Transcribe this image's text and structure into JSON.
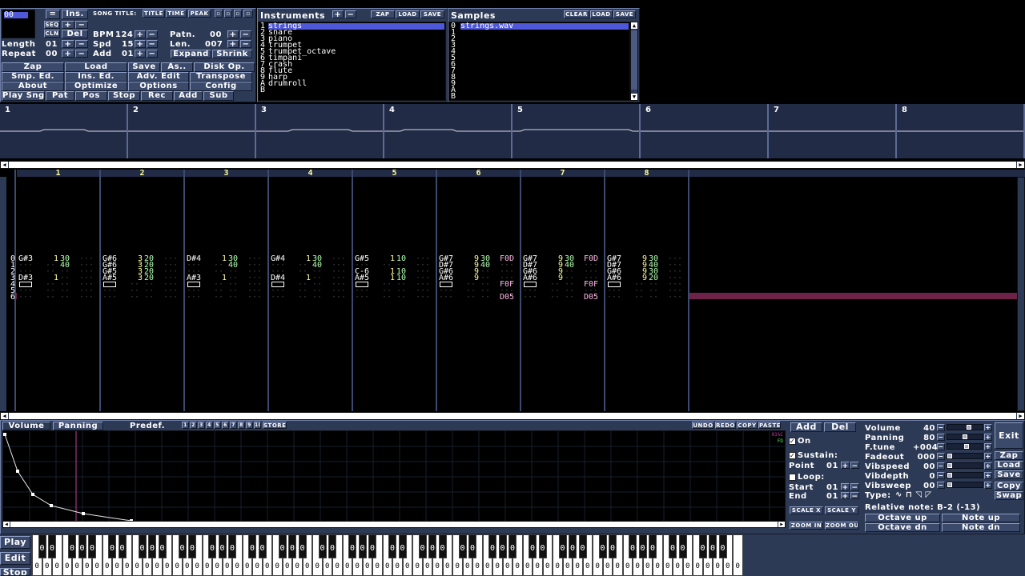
{
  "song": {
    "length_label": "Length",
    "length": "01",
    "repeat_label": "Repeat",
    "repeat": "00",
    "title_label": "SONG TITLE:",
    "title_tab": "TITLE",
    "time_tab": "TIME",
    "peak_tab": "PEAK",
    "bpm_label": "BPM",
    "bpm": "124",
    "spd_label": "Spd",
    "spd": "15",
    "add_label": "Add",
    "add": "01",
    "patn_label": "Patn.",
    "patn": "00",
    "len_label": "Len.",
    "len": "007",
    "expand": "Expand",
    "shrink": "Shrink",
    "pos_display": "00",
    "ins_btn": "Ins.",
    "del_btn": "Del",
    "seq_btn": "SEQ",
    "cln_btn": "CLN",
    "plus": "+",
    "minus": "−"
  },
  "main_buttons": [
    [
      "Zap",
      "Load",
      "Save",
      "As..",
      "Disk Op."
    ],
    [
      "Smp. Ed.",
      "Ins. Ed.",
      "Adv. Edit",
      "Transpose"
    ],
    [
      "About",
      "Optimize",
      "Options",
      "Config"
    ],
    [
      "Play Sng",
      "Pat",
      "Pos",
      "Stop",
      "Rec",
      "Add",
      "Sub"
    ]
  ],
  "instruments": {
    "title": "Instruments",
    "zap": "ZAP",
    "load": "LOAD",
    "save": "SAVE",
    "numbers": [
      "1",
      "2",
      "3",
      "4",
      "5",
      "6",
      "7",
      "8",
      "9",
      "A",
      "B"
    ],
    "items": [
      "strings",
      "snare",
      "piano",
      "trumpet",
      "trumpet_octave",
      "timpani",
      "crash",
      "flute",
      "harp",
      "drumroll",
      ""
    ]
  },
  "samples": {
    "title": "Samples",
    "clear": "CLEAR",
    "load": "LOAD",
    "save": "SAVE",
    "numbers": [
      "0",
      "1",
      "2",
      "3",
      "4",
      "5",
      "6",
      "7",
      "8",
      "9",
      "A",
      "B"
    ],
    "items": [
      "strings.wav",
      "",
      "",
      "",
      "",
      "",
      "",
      "",
      "",
      "",
      "",
      ""
    ]
  },
  "scopes": [
    "1",
    "2",
    "3",
    "4",
    "5",
    "6",
    "7",
    "8"
  ],
  "pattern": {
    "tracks": [
      "1",
      "2",
      "3",
      "4",
      "5",
      "6",
      "7",
      "8"
    ],
    "rows": [
      "0",
      "1",
      "2",
      "3",
      "4",
      "5",
      "6"
    ],
    "cells": [
      [
        [
          "G#3",
          "1",
          "30",
          ""
        ],
        [
          "",
          "",
          "40",
          ""
        ],
        [
          "",
          "",
          "",
          ""
        ],
        [
          "D#3",
          "1",
          "",
          ""
        ],
        [
          "===",
          "",
          "",
          ""
        ],
        [
          "",
          "",
          "",
          ""
        ],
        [
          "",
          "",
          "",
          ""
        ]
      ],
      [
        [
          "G#6",
          "3",
          "20",
          ""
        ],
        [
          "G#6",
          "3",
          "20",
          ""
        ],
        [
          "G#5",
          "3",
          "20",
          ""
        ],
        [
          "A#5",
          "3",
          "20",
          ""
        ],
        [
          "===",
          "",
          "",
          ""
        ],
        [
          "",
          "",
          "",
          ""
        ],
        [
          "",
          "",
          "",
          ""
        ]
      ],
      [
        [
          "D#4",
          "1",
          "30",
          ""
        ],
        [
          "",
          "",
          "40",
          ""
        ],
        [
          "",
          "",
          "",
          ""
        ],
        [
          "A#3",
          "1",
          "",
          ""
        ],
        [
          "===",
          "",
          "",
          ""
        ],
        [
          "",
          "",
          "",
          ""
        ],
        [
          "",
          "",
          "",
          ""
        ]
      ],
      [
        [
          "G#4",
          "1",
          "30",
          ""
        ],
        [
          "",
          "",
          "40",
          ""
        ],
        [
          "",
          "",
          "",
          ""
        ],
        [
          "D#4",
          "1",
          "",
          ""
        ],
        [
          "===",
          "",
          "",
          ""
        ],
        [
          "",
          "",
          "",
          ""
        ],
        [
          "",
          "",
          "",
          ""
        ]
      ],
      [
        [
          "G#5",
          "1",
          "10",
          ""
        ],
        [
          "",
          "",
          "",
          ""
        ],
        [
          "C-6",
          "1",
          "10",
          ""
        ],
        [
          "A#5",
          "1",
          "10",
          ""
        ],
        [
          "===",
          "",
          "",
          ""
        ],
        [
          "",
          "",
          "",
          ""
        ],
        [
          "",
          "",
          "",
          ""
        ]
      ],
      [
        [
          "G#7",
          "9",
          "30",
          "F0D"
        ],
        [
          "D#7",
          "9",
          "40",
          ""
        ],
        [
          "G#6",
          "9",
          "",
          ""
        ],
        [
          "A#6",
          "9",
          "",
          ""
        ],
        [
          "===",
          "",
          "",
          "F0F"
        ],
        [
          "",
          "",
          "",
          ""
        ],
        [
          "",
          "",
          "",
          "D05"
        ]
      ],
      [
        [
          "G#7",
          "9",
          "30",
          "F0D"
        ],
        [
          "D#7",
          "9",
          "40",
          ""
        ],
        [
          "G#6",
          "9",
          "",
          ""
        ],
        [
          "A#6",
          "9",
          "",
          ""
        ],
        [
          "===",
          "",
          "",
          "F0F"
        ],
        [
          "",
          "",
          "",
          ""
        ],
        [
          "",
          "",
          "",
          "D05"
        ]
      ],
      [
        [
          "G#7",
          "9",
          "30",
          ""
        ],
        [
          "D#7",
          "9",
          "40",
          ""
        ],
        [
          "G#6",
          "9",
          "30",
          ""
        ],
        [
          "A#6",
          "9",
          "20",
          ""
        ],
        [
          "===",
          "",
          "",
          ""
        ],
        [
          "",
          "",
          "",
          ""
        ],
        [
          "",
          "",
          "",
          ""
        ]
      ]
    ]
  },
  "env": {
    "volume_tab": "Volume",
    "panning_tab": "Panning",
    "predef": "Predef.",
    "preset_slots": [
      "1",
      "2",
      "3",
      "4",
      "5",
      "6",
      "7",
      "8",
      "9",
      "10"
    ],
    "store": "STORE",
    "undo": "UNDO",
    "redo": "REDO",
    "copy": "COPY",
    "paste": "PASTE",
    "corner_top": "01%C",
    "corner_bot": "FD",
    "add": "Add",
    "del": "Del",
    "on": "On",
    "sustain": "Sustain:",
    "point_label": "Point",
    "point": "01",
    "loop": "Loop:",
    "start_label": "Start",
    "start": "01",
    "end_label": "End",
    "end": "01",
    "scale_x": "SCALE X",
    "scale_y": "SCALE Y",
    "zoom_in": "ZOOM IN",
    "zoom_out": "ZOOM OUT"
  },
  "inst_params": {
    "volume_label": "Volume",
    "volume": "40",
    "panning_label": "Panning",
    "panning": "80",
    "ftune_label": "F.tune",
    "ftune": "+004",
    "fadeout_label": "Fadeout",
    "fadeout": "000",
    "vibspeed_label": "Vibspeed",
    "vibspeed": "00",
    "vibdepth_label": "Vibdepth",
    "vibdepth": "0",
    "vibsweep_label": "Vibsweep",
    "vibsweep": "00",
    "type_label": "Type:",
    "relative_note": "Relative note: B-2 (-13)",
    "octave_up": "Octave up",
    "note_up": "Note up",
    "octave_dn": "Octave dn",
    "note_dn": "Note dn",
    "exit": "Exit",
    "zap": "Zap",
    "load": "Load",
    "save": "Save",
    "copy": "Copy",
    "swap": "Swap"
  },
  "keyboard": {
    "play": "Play",
    "edit": "Edit",
    "stop": "Stop",
    "key_value": "0"
  }
}
